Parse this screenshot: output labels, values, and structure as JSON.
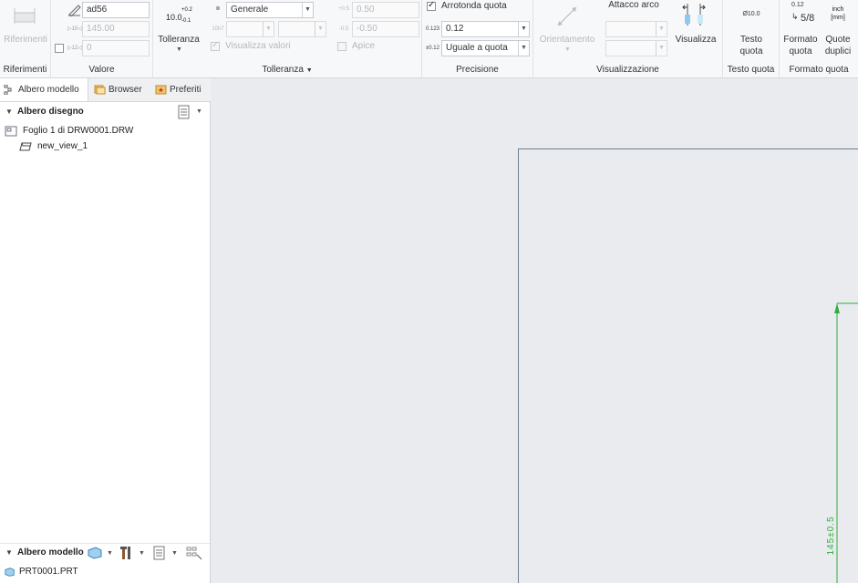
{
  "ribbon": {
    "riferimenti": {
      "button_label": "Riferimenti",
      "group_label": "Riferimenti"
    },
    "valore": {
      "group_label": "Valore",
      "name_value": "ad56",
      "nominal_value": "145.00",
      "override_value": "0"
    },
    "tolleranza": {
      "button_label": "Tolleranza",
      "icon_text": "10.0",
      "icon_sup": "+0.2",
      "icon_sub": "-0.1",
      "type_value": "Generale",
      "upper_value": "0.50",
      "lower_value": "-0.50",
      "show_values_label": "Visualizza valori",
      "apice_label": "Apice",
      "group_label": "Tolleranza"
    },
    "precisione": {
      "round_label": "Arrotonda quota",
      "decimals_value": "0.12",
      "tolerance_precision_value": "Uguale a quota",
      "group_label": "Precisione"
    },
    "visualizzazione": {
      "orientamento_label": "Orientamento",
      "attacco_arco_label": "Attacco arco",
      "visualizza_label": "Visualizza",
      "group_label": "Visualizzazione"
    },
    "testo_quota": {
      "icon_text": "Ø10.0",
      "button_line1": "Testo",
      "button_line2": "quota",
      "group_label": "Testo quota"
    },
    "formato_quota": {
      "format_icon_top": "0.12",
      "format_icon_main": "5/8",
      "format_line1": "Formato",
      "format_line2": "quota",
      "dual_icon_top": "inch",
      "dual_icon_bottom": "[mm]",
      "dual_line1": "Quote",
      "dual_line2": "duplici",
      "group_label": "Formato quota"
    }
  },
  "left_panel": {
    "tabs": [
      "Albero modello",
      "Browser",
      "Preferiti"
    ],
    "drawing_tree": {
      "title": "Albero disegno",
      "items": [
        "Foglio 1 di DRW0001.DRW",
        "new_view_1"
      ]
    },
    "model_tree": {
      "title": "Albero modello",
      "items": [
        "PRT0001.PRT"
      ]
    }
  },
  "canvas": {
    "dimension_text": "145±0.5",
    "accent_color": "#2fae3c",
    "sheet_border_color": "#6f7d92"
  }
}
